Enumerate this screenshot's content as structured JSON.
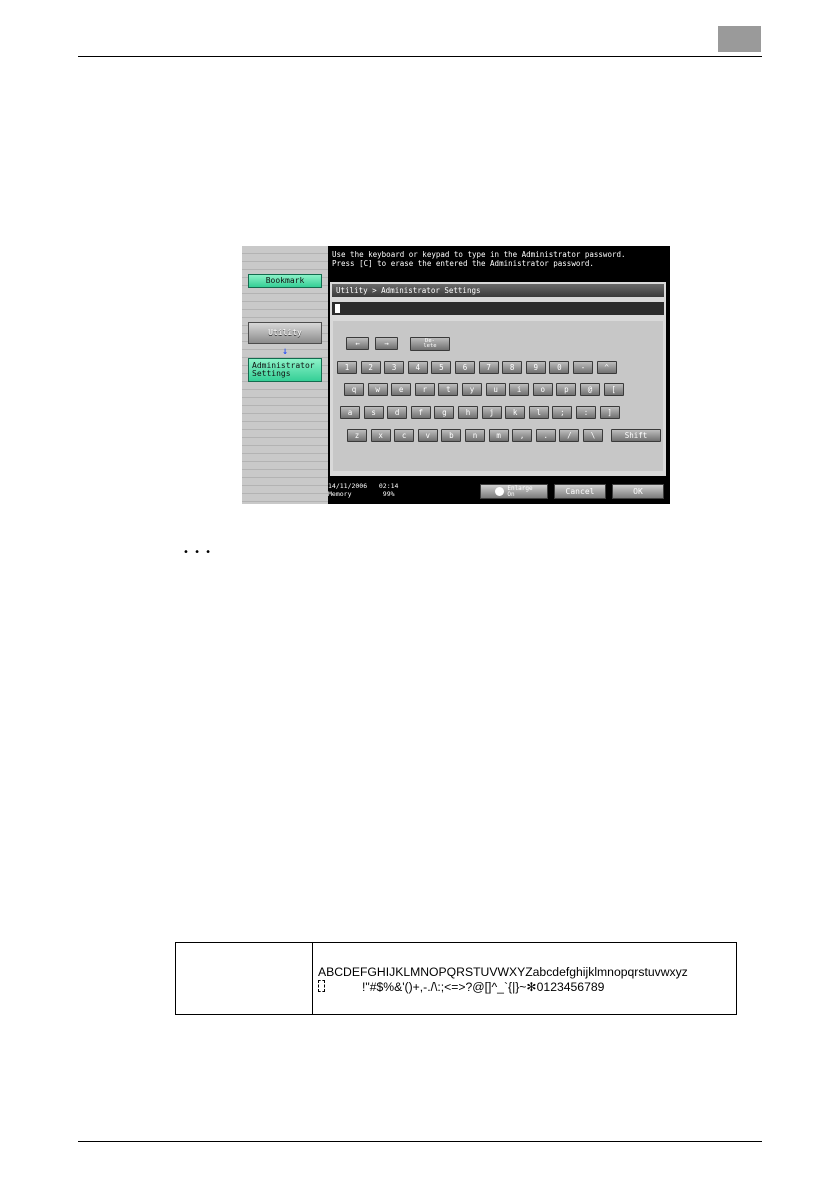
{
  "screen": {
    "message_line1": "Use the keyboard or keypad to type in the Administrator password.",
    "message_line2": "Press [C] to erase the entered the Administrator password.",
    "sidebar": {
      "bookmark_label": "Bookmark",
      "utility_label": "Utility",
      "admin_label_line1": "Administrator",
      "admin_label_line2": "Settings",
      "arrow_glyph": "↓"
    },
    "breadcrumb": "Utility > Administrator Settings",
    "nav_keys": {
      "left": "←",
      "right": "→",
      "delete_line1": "De-",
      "delete_line2": "lete"
    },
    "keyboard_rows": [
      [
        "1",
        "2",
        "3",
        "4",
        "5",
        "6",
        "7",
        "8",
        "9",
        "0",
        "-",
        "^"
      ],
      [
        "q",
        "w",
        "e",
        "r",
        "t",
        "y",
        "u",
        "i",
        "o",
        "p",
        "@",
        "["
      ],
      [
        "a",
        "s",
        "d",
        "f",
        "g",
        "h",
        "j",
        "k",
        "l",
        ";",
        ":",
        "]"
      ],
      [
        "z",
        "x",
        "c",
        "v",
        "b",
        "n",
        "m",
        ",",
        ".",
        "/",
        "\\"
      ]
    ],
    "shift_label": "Shift",
    "enlarge_label_line1": "Enlarge",
    "enlarge_label_line2": "On",
    "cancel_label": "Cancel",
    "ok_label": "OK",
    "status_date": "14/11/2006",
    "status_time": "02:14",
    "status_memory_label": "Memory",
    "status_memory_value": "99%"
  },
  "note_dots": "• • •",
  "character_table": {
    "chars_line1": "ABCDEFGHIJKLMNOPQRSTUVWXYZabcdefghijklmnopqrstuvwxyz",
    "chars_line2": "!\"#$%&'()+,-./\\:;<=>?@[]^_`{|}~✻0123456789"
  }
}
